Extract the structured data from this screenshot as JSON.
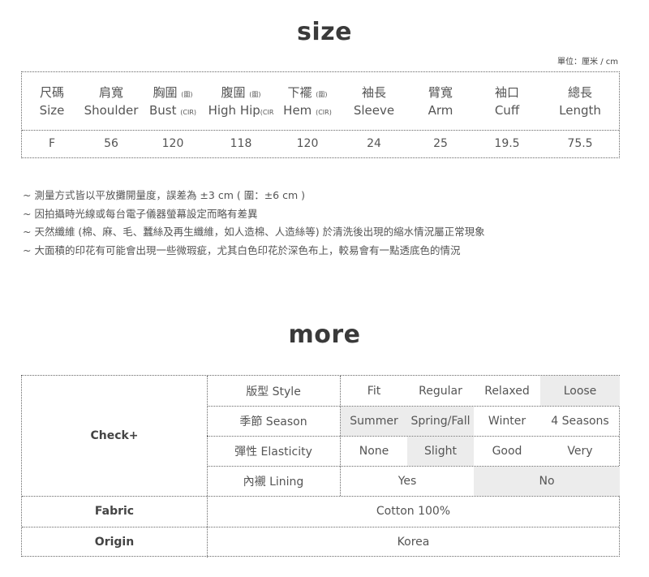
{
  "size_section": {
    "title": "size",
    "unit": "單位：厘米 / cm",
    "columns": [
      {
        "zh": "尺碼",
        "zh_note": "",
        "en": "Size",
        "en_note": "",
        "value": "F"
      },
      {
        "zh": "肩寬",
        "zh_note": "",
        "en": "Shoulder",
        "en_note": "",
        "value": "56"
      },
      {
        "zh": "胸圍",
        "zh_note": "(圍)",
        "en": "Bust",
        "en_note": "(CIR)",
        "value": "120"
      },
      {
        "zh": "腹圍",
        "zh_note": "(圍)",
        "en": "High Hip",
        "en_note": "(CIR",
        "value": "118"
      },
      {
        "zh": "下襬",
        "zh_note": "(圍)",
        "en": "Hem",
        "en_note": "(CIR)",
        "value": "120"
      },
      {
        "zh": "袖長",
        "zh_note": "",
        "en": "Sleeve",
        "en_note": "",
        "value": "24"
      },
      {
        "zh": "臂寬",
        "zh_note": "",
        "en": "Arm",
        "en_note": "",
        "value": "25"
      },
      {
        "zh": "袖口",
        "zh_note": "",
        "en": "Cuff",
        "en_note": "",
        "value": "19.5"
      },
      {
        "zh": "總長",
        "zh_note": "",
        "en": "Length",
        "en_note": "",
        "value": "75.5"
      }
    ]
  },
  "notes": [
    "~ 測量方式皆以平放攤開量度，誤差為 ±3 cm ( 圍：±6 cm )",
    "~ 因拍攝時光線或每台電子儀器螢幕設定而略有差異",
    "~ 天然纖維 (棉、麻、毛、蠶絲及再生纖維，如人造棉、人造絲等) 於清洗後出現的縮水情況屬正常現象",
    "~ 大面積的印花有可能會出現一些微瑕疵，尤其白色印花於深色布上，較易會有一點透底色的情況"
  ],
  "more_section": {
    "title": "more",
    "check_label": "Check+",
    "rows": [
      {
        "label": "版型 Style",
        "options": [
          "Fit",
          "Regular",
          "Relaxed",
          "Loose"
        ],
        "selected": [
          3
        ]
      },
      {
        "label": "季節 Season",
        "options": [
          "Summer",
          "Spring/Fall",
          "Winter",
          "4 Seasons"
        ],
        "selected": [
          0,
          1
        ]
      },
      {
        "label": "彈性 Elasticity",
        "options": [
          "None",
          "Slight",
          "Good",
          "Very"
        ],
        "selected": [
          1
        ]
      },
      {
        "label": "內襯 Lining",
        "options": [
          "Yes",
          "No"
        ],
        "selected": [
          1
        ]
      }
    ],
    "fabric_label": "Fabric",
    "fabric_value": "Cotton 100%",
    "origin_label": "Origin",
    "origin_value": "Korea"
  }
}
